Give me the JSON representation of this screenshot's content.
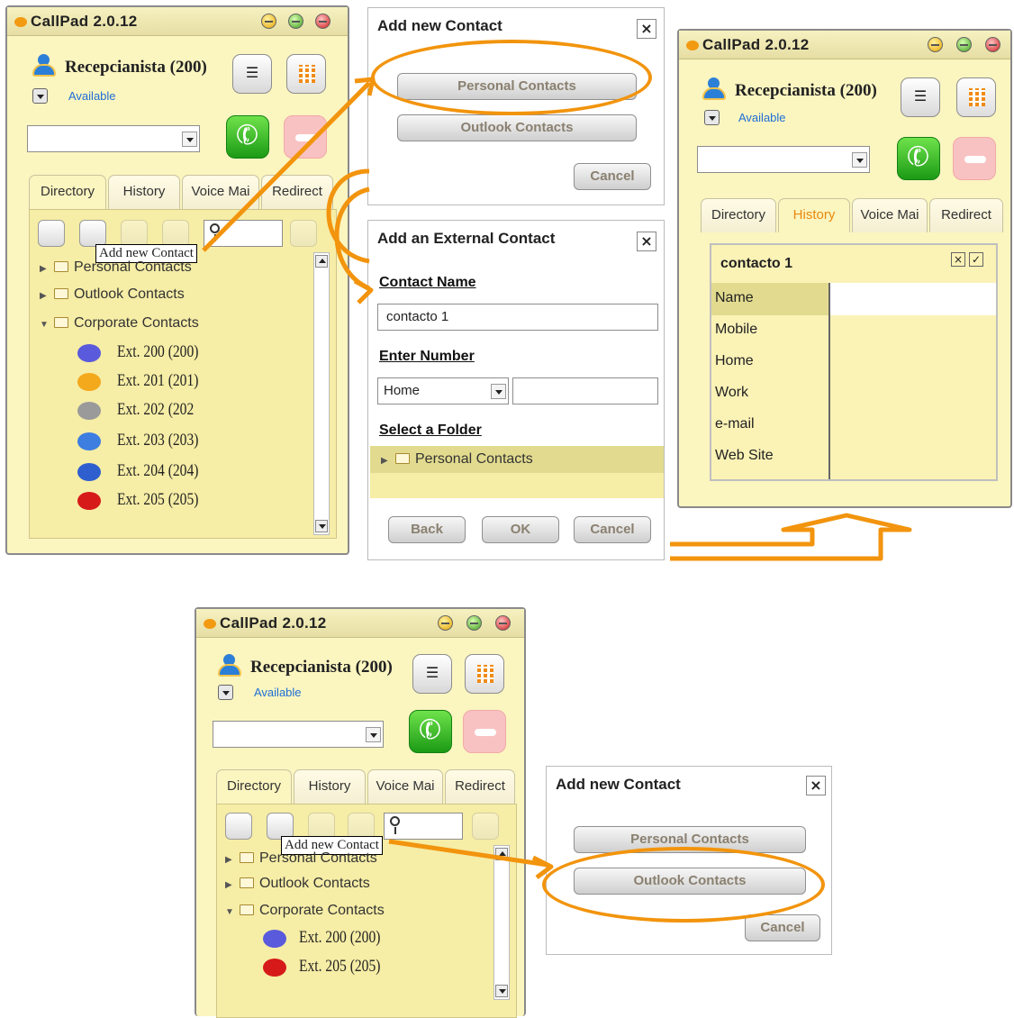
{
  "app": {
    "title": "CallPad 2.0.12",
    "user_name": "Recepcianista (200)",
    "status": "Available"
  },
  "tabs": {
    "directory": "Directory",
    "history": "History",
    "voicemail": "Voice Mai",
    "redirect": "Redirect"
  },
  "tooltip": "Add new Contact",
  "tree": {
    "personal": "Personal Contacts",
    "outlook": "Outlook Contacts",
    "corporate": "Corporate Contacts"
  },
  "extensions": [
    {
      "label": "Ext. 200 (200)",
      "color": "#5a5adc"
    },
    {
      "label": "Ext. 201 (201)",
      "color": "#f4a81c"
    },
    {
      "label": "Ext. 202 (202",
      "color": "#9a9a9a"
    },
    {
      "label": "Ext. 203 (203)",
      "color": "#3d7ee0"
    },
    {
      "label": "Ext. 204 (204)",
      "color": "#2f5fcf"
    },
    {
      "label": "Ext. 205 (205)",
      "color": "#d61a1a"
    }
  ],
  "add_dialog": {
    "title": "Add new Contact",
    "personal_btn": "Personal Contacts",
    "outlook_btn": "Outlook Contacts",
    "cancel": "Cancel"
  },
  "external_dialog": {
    "title": "Add an External Contact",
    "contact_name_label": "Contact Name",
    "contact_name_value": "contacto 1",
    "enter_number_label": "Enter Number",
    "number_type": "Home",
    "number_value": "",
    "folder_label": "Select a Folder",
    "folder_item": "Personal Contacts",
    "back": "Back",
    "ok": "OK",
    "cancel": "Cancel"
  },
  "contact_card": {
    "title": "contacto 1",
    "fields": [
      "Name",
      "Mobile",
      "Home",
      "Work",
      "e-mail",
      "Web Site"
    ]
  },
  "colors": {
    "accent": "#f2940d",
    "window_bg": "#fbf5c0",
    "panel_bg": "#f6eda6",
    "status_link": "#1e6ed6",
    "call_green": "#1c9a15"
  }
}
